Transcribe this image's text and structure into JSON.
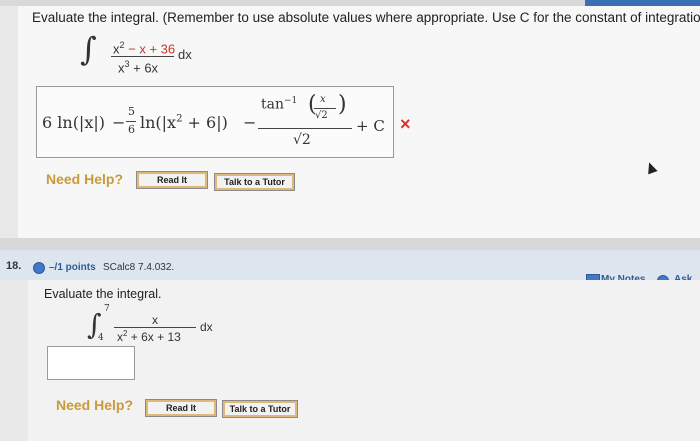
{
  "topbar": {
    "label": "My Notes",
    "ask_label": "Ask"
  },
  "q17": {
    "prompt": "Evaluate the integral. (Remember to use absolute values where appropriate. Use C for the constant of integration.",
    "integrand_num_black": "x",
    "integrand_num_sup": "2",
    "integrand_num_red": " − x + 36",
    "integrand_den_a": "x",
    "integrand_den_sup": "3",
    "integrand_den_b": " + 6x",
    "dx": "dx",
    "answer": {
      "part1": "6 ln",
      "part1_arg": "(|x|)",
      "minus1": "−",
      "coef_num": "5",
      "coef_den": "6",
      "ln2": "ln",
      "ln2_arg_a": "(|x",
      "ln2_sup": "2",
      "ln2_arg_b": " + 6|)",
      "minus2": "−",
      "tan_label": "tan",
      "tan_sup": "−1",
      "tan_inner_num": "x",
      "tan_inner_den": "√2",
      "outer_den": "√2",
      "plus_c": "+ C"
    },
    "status_mark": "×",
    "need_help": "Need Help?",
    "read_it": "Read It",
    "talk_tutor": "Talk to a Tutor"
  },
  "q18": {
    "number": "18.",
    "points": "–/1 points",
    "source": "SCalc8 7.4.032.",
    "my_notes": "My Notes",
    "ask": "Ask",
    "prompt": "Evaluate the integral.",
    "upper": "7",
    "lower": "4",
    "num": "x",
    "den_a": "x",
    "den_sup": "2",
    "den_b": " + 6x + 13",
    "dx": "dx",
    "answer_value": "",
    "need_help": "Need Help?",
    "read_it": "Read It",
    "talk_tutor": "Talk to a Tutor"
  }
}
